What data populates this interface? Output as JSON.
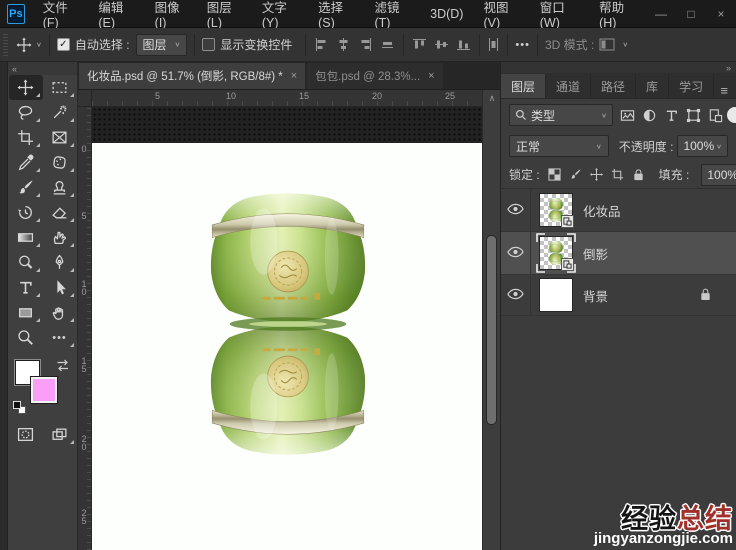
{
  "icons": {
    "check": "✓",
    "chevron_down": "∨",
    "collapse_left": "«",
    "collapse_right": "»",
    "menu": "≡",
    "more": "•••",
    "minimize": "—",
    "maximize": "□",
    "close": "×",
    "tab_close": "×",
    "scroll_up": "∧"
  },
  "menubar": {
    "logo": "Ps",
    "items": [
      {
        "label": "文件(F)"
      },
      {
        "label": "编辑(E)"
      },
      {
        "label": "图像(I)"
      },
      {
        "label": "图层(L)"
      },
      {
        "label": "文字(Y)"
      },
      {
        "label": "选择(S)"
      },
      {
        "label": "滤镜(T)"
      },
      {
        "label": "3D(D)"
      },
      {
        "label": "视图(V)"
      },
      {
        "label": "窗口(W)"
      },
      {
        "label": "帮助(H)"
      }
    ]
  },
  "options": {
    "auto_select_label": "自动选择 :",
    "auto_select_value": "图层",
    "show_transform_label": "显示变换控件",
    "mode_label": "3D 模式 :"
  },
  "tabs": [
    {
      "title": "化妆品.psd @ 51.7% (倒影, RGB/8#) *"
    },
    {
      "title": "包包.psd @ 28.3%..."
    }
  ],
  "rulers": {
    "h": [
      "5",
      "10",
      "15",
      "20",
      "25"
    ],
    "v": [
      "0",
      "5",
      "10",
      "15",
      "20",
      "25"
    ]
  },
  "panel": {
    "tabs": [
      {
        "label": "图层"
      },
      {
        "label": "通道"
      },
      {
        "label": "路径"
      },
      {
        "label": "库"
      },
      {
        "label": "学习"
      }
    ],
    "filter_value": "类型",
    "blend_mode": "正常",
    "opacity_label": "不透明度 :",
    "opacity_value": "100%",
    "lock_label": "锁定 :",
    "fill_label": "填充 :",
    "fill_value": "100%",
    "layers": [
      {
        "name": "化妆品"
      },
      {
        "name": "倒影"
      },
      {
        "name": "背景"
      }
    ]
  },
  "watermark": {
    "line1_black": "经验",
    "line1_red": "总结",
    "line2": "jingyanzongjie.com"
  },
  "colors": {
    "accent_blue": "#31a8ff",
    "background_swatch_pink": "#fb9ef7",
    "jar_green": "#8fba48",
    "watermark_red": "#a2302a"
  }
}
